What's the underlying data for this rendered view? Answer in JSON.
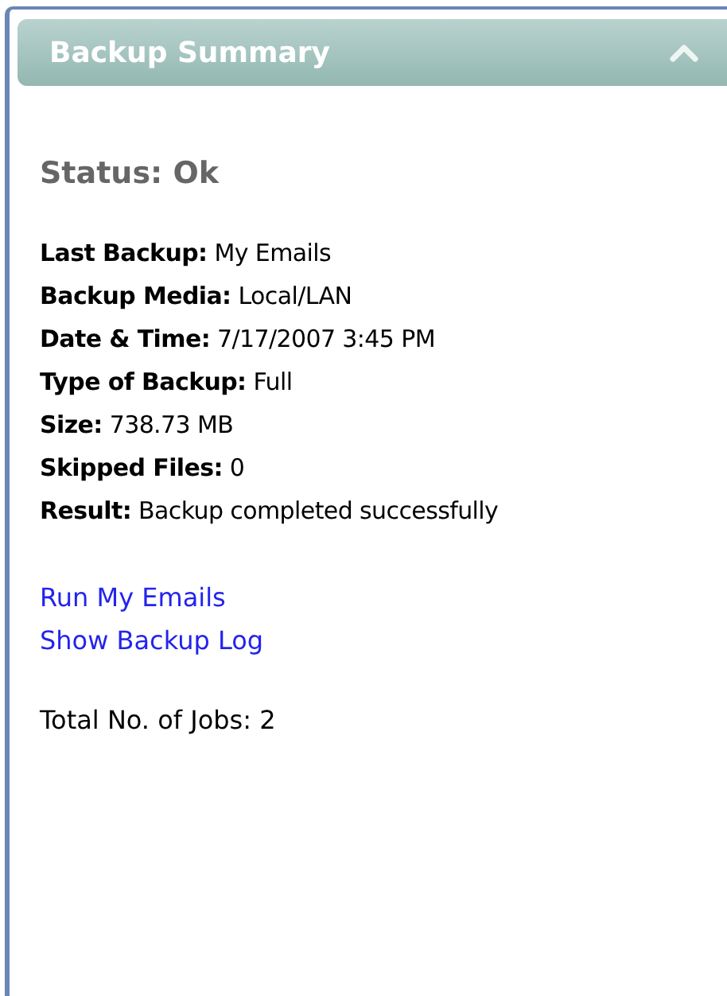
{
  "panel": {
    "title": "Backup Summary",
    "expanded": true
  },
  "status": "Status: Ok",
  "details": [
    {
      "label": "Last Backup:",
      "value": "My Emails"
    },
    {
      "label": "Backup Media:",
      "value": "Local/LAN"
    },
    {
      "label": "Date & Time:",
      "value": "7/17/2007 3:45 PM"
    },
    {
      "label": "Type of Backup:",
      "value": "Full"
    },
    {
      "label": "Size:",
      "value": "738.73 MB"
    },
    {
      "label": "Skipped Files:",
      "value": "0"
    },
    {
      "label": "Result:",
      "value": "Backup completed successfully"
    }
  ],
  "links": [
    "Run My Emails",
    "Show Backup Log"
  ],
  "total_jobs": "Total No. of Jobs: 2"
}
